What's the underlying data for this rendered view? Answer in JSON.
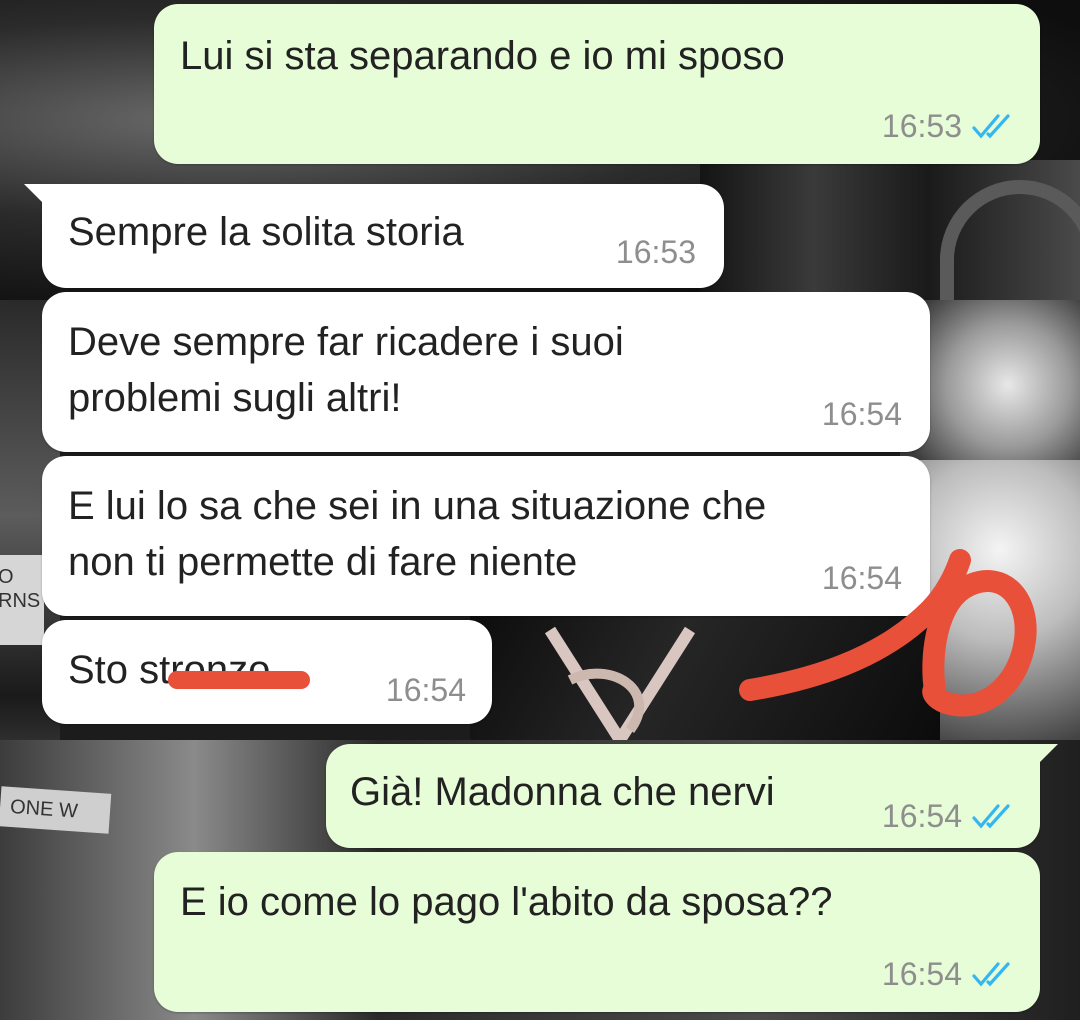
{
  "colors": {
    "outgoing_bubble": "#e6fdd7",
    "incoming_bubble": "#ffffff",
    "timestamp": "#8e8e8e",
    "read_ticks": "#34b7f1",
    "annotation_red": "#e8503a"
  },
  "messages": [
    {
      "direction": "outgoing",
      "text": "Lui si sta separando e io mi sposo",
      "time": "16:53",
      "status_icon": "double-check-icon"
    },
    {
      "direction": "incoming",
      "text": "Sempre la solita storia",
      "time": "16:53"
    },
    {
      "direction": "incoming",
      "text": "Deve sempre far ricadere i suoi\nproblemi sugli altri!",
      "time": "16:54"
    },
    {
      "direction": "incoming",
      "text": "E lui lo sa che sei in una situazione che\nnon ti permette di fare niente",
      "time": "16:54"
    },
    {
      "direction": "incoming",
      "text": "Sto stronzo",
      "time": "16:54"
    },
    {
      "direction": "outgoing",
      "text": "Già! Madonna che nervi",
      "time": "16:54",
      "status_icon": "double-check-icon"
    },
    {
      "direction": "outgoing",
      "text": "E io come lo pago l'abito da sposa??",
      "time": "16:54",
      "status_icon": "double-check-icon"
    }
  ],
  "annotation": {
    "handwritten_text": "10"
  },
  "wallpaper": {
    "sign_text_1": "ONE W",
    "sign_text_2": "O\nRNS"
  }
}
